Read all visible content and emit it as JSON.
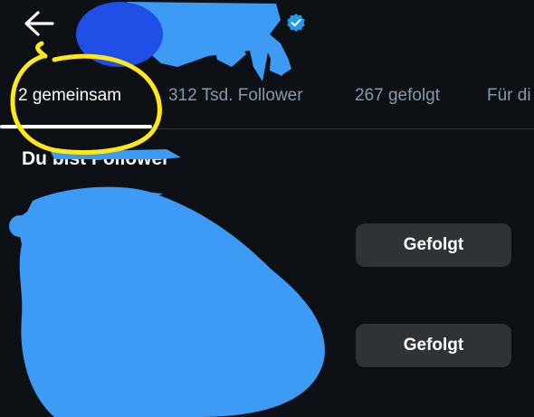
{
  "tabs": [
    {
      "label": "2 gemeinsam",
      "active": true
    },
    {
      "label": "312 Tsd. Follower",
      "active": false
    },
    {
      "label": "267 gefolgt",
      "active": false
    },
    {
      "label": "Für di",
      "active": false
    }
  ],
  "section": {
    "title": "Du bist Follower"
  },
  "list": [
    {
      "button_label": "Gefolgt"
    },
    {
      "button_label": "Gefolgt"
    }
  ],
  "icons": {
    "back": "arrow-left-icon",
    "verified": "verified-badge-icon"
  },
  "colors": {
    "background": "#0d1116",
    "tab_inactive": "#8b98a5",
    "button_bg": "#2f3336",
    "verified": "#1d9bf0",
    "redaction": "#3d9bf5",
    "redaction_dark": "#1f4fe6",
    "highlight": "#ffe81a"
  }
}
